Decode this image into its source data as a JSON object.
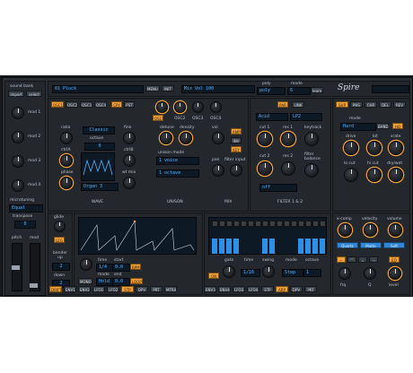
{
  "browser": {
    "title": "sound bank",
    "import_label": "import",
    "select_label": "select",
    "mod_labels": [
      "mod 1",
      "mod 2",
      "mod 3",
      "mod 4"
    ],
    "microtuning_label": "microtuning",
    "microtuning_value": "Equal",
    "transpose_label": "transpose",
    "pitch_label": "pitch",
    "mod_label": "mod"
  },
  "header": {
    "patch_name": "01 Pluck",
    "menu_label": "MENU",
    "init_label": "INIT",
    "bank_name": "Mix Vol 100",
    "poly_label": "poly",
    "mode_label": "mode",
    "learn_label": "learn",
    "logo": "Spire"
  },
  "osc": {
    "tabs": [
      "OSC1",
      "OSC2",
      "OSC3",
      "OSC4"
    ],
    "ctrl_a_label": "ctrlA",
    "ctrl_b_label": "ctrlB",
    "ratio_label": "ratio",
    "octave_label": "octave",
    "note_label": "note",
    "fine_label": "fine",
    "wave_value": "Classic",
    "phase_label": "phase",
    "wt_mix_label": "wt mix",
    "wave_label": "WAVE",
    "osc_select": "Organ 3",
    "unison_mode_label": "unison mode",
    "unison_value": "1 voice",
    "detune_label": "detune",
    "density_label": "density",
    "unison_label": "UNISON",
    "vol_label": "vol",
    "pan_label": "pan",
    "filter_input_label": "filter input",
    "mix_label": "MIX",
    "osc_knob_labels": [
      "OSC1",
      "OSC2",
      "OSC3",
      "OSC4"
    ]
  },
  "filter": {
    "par_label": "PAR",
    "link_label": "LINK",
    "cut1_label": "cut 1",
    "res1_label": "res 1",
    "keytrack_label": "keytrack",
    "cut2_label": "cut 2",
    "res2_label": "res 2",
    "balance_label": "filter balance",
    "type1": "Acid",
    "type2": "LP2",
    "type3": "off",
    "title": "FILTER 1 & 2"
  },
  "fx": {
    "tabs": [
      "SHP",
      "PHS",
      "CHR",
      "DEL",
      "REV"
    ],
    "mode_label": "mode",
    "mode_value": "Hard",
    "band_label": "BAND",
    "hq_label": "HQ",
    "drive_label": "drive",
    "bit_label": "bit",
    "srate_label": "srate",
    "lo_cut_label": "lo cut",
    "hi_cut_label": "hi cut",
    "dry_wet_label": "dry/wet"
  },
  "env": {
    "glide_label": "glide",
    "legato_label": "LEG",
    "bender_up_label": "bender up",
    "bender_down_label": "down",
    "time_label": "time",
    "start_label": "start",
    "end_label": "end",
    "mode_label": "mode",
    "mono_label": "MONO",
    "mode_value": "Hold",
    "bpm_label": "BPM",
    "loop_label": "LOOP",
    "time_value": "1/4",
    "start_value": "0.0",
    "end_value": "0.0",
    "tabs": [
      "DRIFT",
      "ENV1",
      "ENV2",
      "LFO1",
      "LFO2",
      "STP",
      "DPV",
      "PRT",
      "MTRX"
    ]
  },
  "arp": {
    "gate_label": "gate",
    "time_label": "time",
    "swing_label": "swing",
    "mode_label": "mode",
    "octave_label": "octave",
    "on_label": "ON",
    "time_value": "1/16",
    "mode_value": "Step",
    "octave_value": "1",
    "tabs": [
      "ENV3",
      "ENV4",
      "LFO3",
      "LFO4",
      "STP",
      "ARP",
      "DPV",
      "PRT"
    ],
    "steps": [
      0.42,
      0.42,
      0.42,
      0.42,
      0,
      0,
      0,
      0.42,
      0.42,
      0,
      0,
      0,
      0.42,
      0.42,
      0.42,
      0.42
    ]
  },
  "master": {
    "x_comp_label": "x-comp",
    "velocity_label": "velocity",
    "volume_label": "volume",
    "eq_label": "EQ",
    "frq_label": "frq",
    "q_label": "Q",
    "level_label": "level",
    "eq_buttons": [
      "Quartz",
      "Matte",
      "Soft"
    ]
  },
  "colors": {
    "orange": "#f2a23a",
    "blue": "#2d90e6",
    "panel": "#24282d"
  }
}
